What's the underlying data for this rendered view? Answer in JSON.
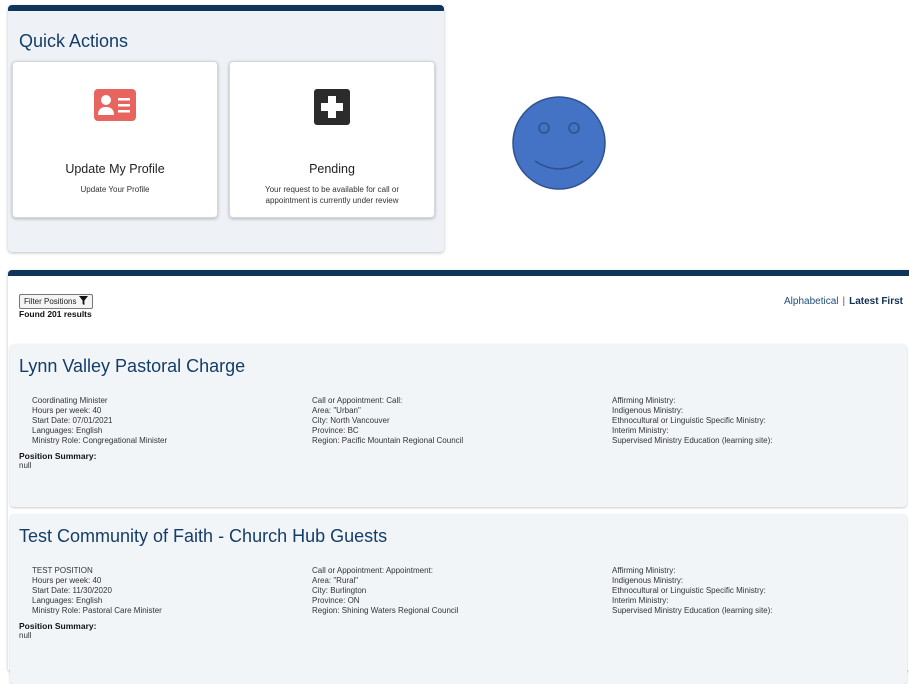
{
  "quick_actions": {
    "title": "Quick Actions",
    "cards": [
      {
        "title": "Update My Profile",
        "subtitle": "Update Your Profile",
        "icon": "profile-card-icon",
        "icon_color": "#e8645f"
      },
      {
        "title": "Pending",
        "subtitle": "Your request to be available for call or appointment is currently under review",
        "icon": "plus-icon",
        "icon_color": "#2b2b2b"
      }
    ]
  },
  "smiley": {
    "icon": "smiley-face-icon",
    "fill": "#4472c4",
    "stroke": "#2f528f"
  },
  "results": {
    "filter_button": "Filter Positions",
    "found": "Found 201 results",
    "sort": {
      "option_1": "Alphabetical",
      "separator": "|",
      "option_2": "Latest First"
    },
    "positions": [
      {
        "title": "Lynn Valley Pastoral Charge",
        "col1": [
          "Coordinating Minister",
          "Hours per week: 40",
          "Start Date: 07/01/2021",
          "Languages: English",
          "Ministry Role: Congregational Minister"
        ],
        "col2": [
          "Call or Appointment: Call:",
          "Area: \"Urban\"",
          "City: North Vancouver",
          "Province: BC",
          "Region: Pacific Mountain Regional Council"
        ],
        "col3": [
          "Affirming Ministry:",
          "Indigenous Ministry:",
          "Ethnocultural or Linguistic Specific Ministry:",
          "Interim Ministry:",
          "Supervised Ministry Education (learning site):"
        ],
        "summary_label": "Position Summary:",
        "summary_value": "null"
      },
      {
        "title": "Test Community of Faith - Church Hub Guests",
        "col1": [
          "TEST POSITION",
          "Hours per week: 40",
          "Start Date: 11/30/2020",
          "Languages: English",
          "Ministry Role: Pastoral Care Minister"
        ],
        "col2": [
          "Call or Appointment: Appointment:",
          "Area: \"Rural\"",
          "City: Burlington",
          "Province: ON",
          "Region: Shining Waters Regional Council"
        ],
        "col3": [
          "Affirming Ministry:",
          "Indigenous Ministry:",
          "Ethnocultural or Linguistic Specific Ministry:",
          "Interim Ministry:",
          "Supervised Ministry Education (learning site):"
        ],
        "summary_label": "Position Summary:",
        "summary_value": "null"
      }
    ]
  }
}
